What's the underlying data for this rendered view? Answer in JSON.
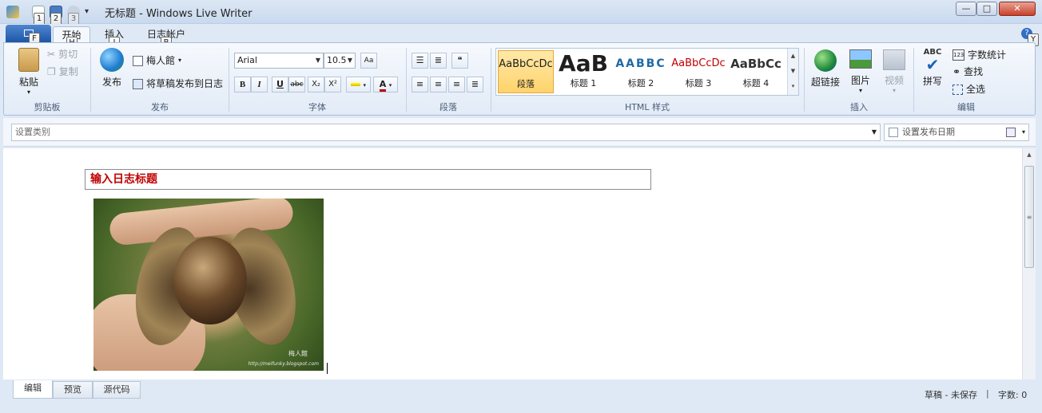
{
  "window": {
    "title": "无标题 - Windows Live Writer",
    "minimize": "—",
    "maximize": "□",
    "close": "✕"
  },
  "quick_access": {
    "keytips": [
      "1",
      "2",
      "3"
    ]
  },
  "ribbon_tabs": {
    "file_keytip": "F",
    "tabs": [
      {
        "label": "开始",
        "keytip": "H"
      },
      {
        "label": "插入",
        "keytip": "I"
      },
      {
        "label": "日志帐户",
        "keytip": "B"
      }
    ],
    "help_keytip": "Y"
  },
  "clipboard": {
    "paste": "粘贴",
    "cut": "剪切",
    "copy": "复制",
    "label": "剪贴板"
  },
  "publish": {
    "publish": "发布",
    "blog_name": "梅人館",
    "save_draft": "将草稿发布到日志",
    "label": "发布"
  },
  "font": {
    "family": "Arial",
    "size": "10.5",
    "bold": "B",
    "italic": "I",
    "underline": "U",
    "strike": "abc",
    "subscript": "X₂",
    "superscript": "X²",
    "color_letter": "A",
    "label": "字体"
  },
  "paragraph": {
    "label": "段落"
  },
  "html_styles": {
    "items": [
      {
        "sample": "AaBbCcDc",
        "name": "段落"
      },
      {
        "sample": "AaB",
        "name": "标题 1"
      },
      {
        "sample": "AABBC",
        "name": "标题 2"
      },
      {
        "sample": "AaBbCcDc",
        "name": "标题 3"
      },
      {
        "sample": "AaBbCc",
        "name": "标题 4"
      }
    ],
    "label": "HTML 样式"
  },
  "insert": {
    "hyperlink": "超链接",
    "picture": "图片",
    "video": "视频",
    "label": "插入"
  },
  "editing": {
    "spell_abc": "ABC",
    "spell": "拼写",
    "word_count": "字数统计",
    "find": "查找",
    "select_all": "全选",
    "label": "编辑"
  },
  "category": {
    "placeholder": "设置类别",
    "publish_date": "设置发布日期"
  },
  "editor": {
    "title_placeholder": "输入日志标题",
    "watermark_name": "梅人館",
    "watermark_url": "http://meifunky.blogspot.com"
  },
  "bottom": {
    "tabs": [
      "编辑",
      "预览",
      "源代码"
    ],
    "status": "草稿 - 未保存",
    "separator": "|",
    "word_count": "字数: 0"
  },
  "colors": {
    "accent": "#1e56a8",
    "title_red": "#c00000",
    "ribbon_border": "#a9bfd8"
  }
}
